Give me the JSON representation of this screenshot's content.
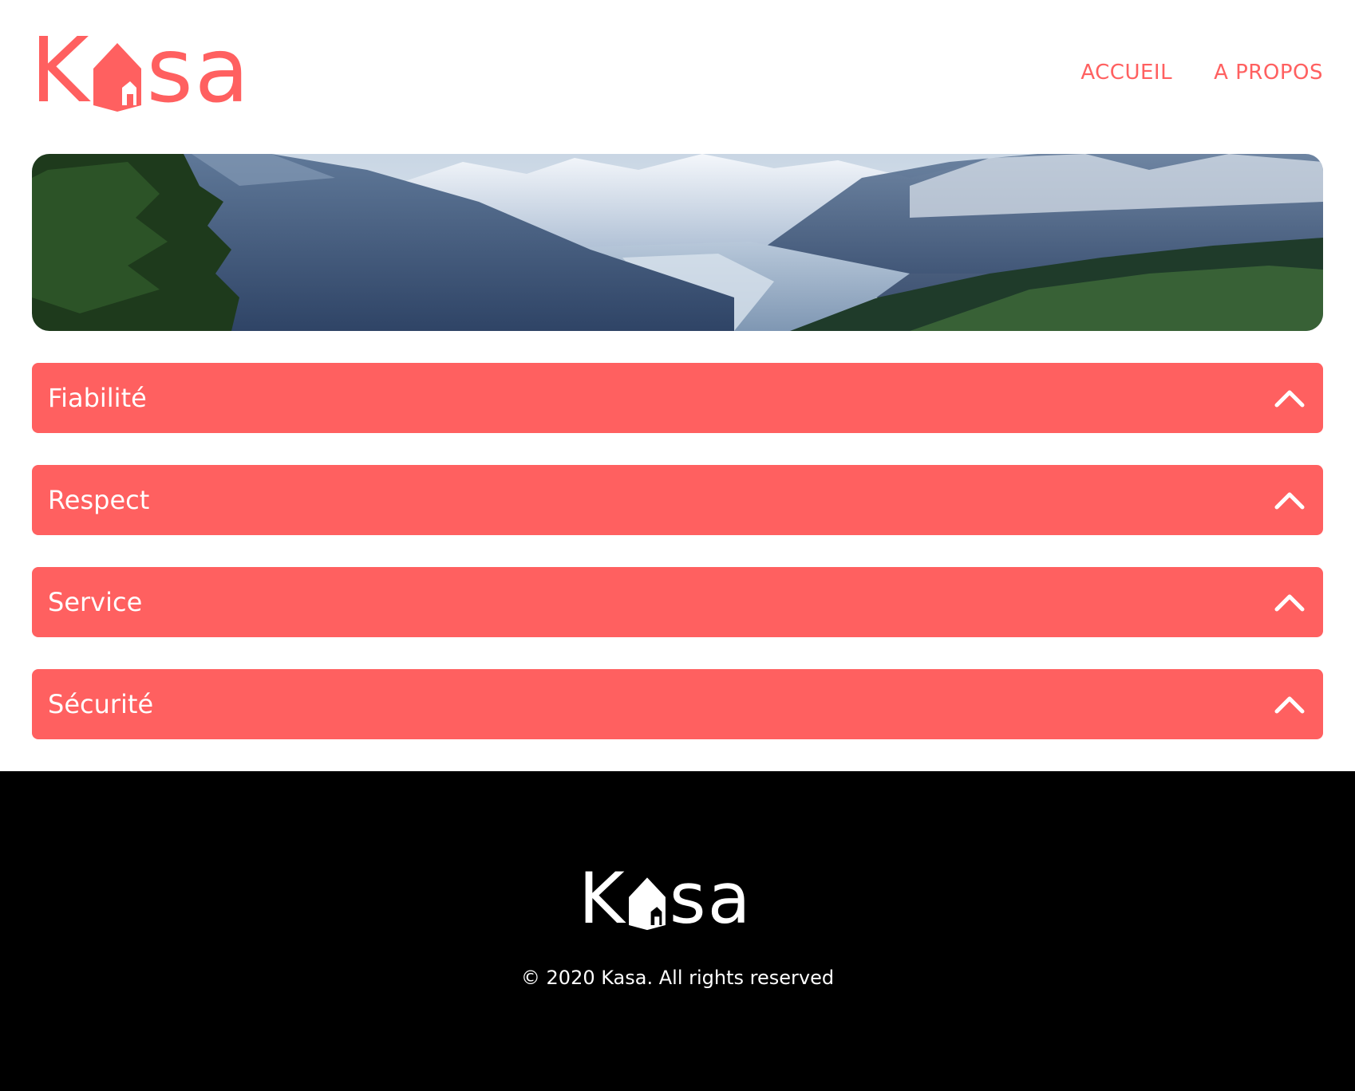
{
  "brand": {
    "logo_text_left": "K",
    "logo_text_right": "sa",
    "primary_color": "#FF6060",
    "icon": "house-icon"
  },
  "nav": {
    "items": [
      {
        "label": "ACCUEIL"
      },
      {
        "label": "A PROPOS"
      }
    ]
  },
  "banner": {
    "image": "mountain-landscape"
  },
  "collapses": [
    {
      "title": "Fiabilité",
      "icon": "chevron-up-icon"
    },
    {
      "title": "Respect",
      "icon": "chevron-up-icon"
    },
    {
      "title": "Service",
      "icon": "chevron-up-icon"
    },
    {
      "title": "Sécurité",
      "icon": "chevron-up-icon"
    }
  ],
  "footer": {
    "logo_text_left": "K",
    "logo_text_right": "sa",
    "copyright": "© 2020 Kasa. All rights reserved"
  }
}
